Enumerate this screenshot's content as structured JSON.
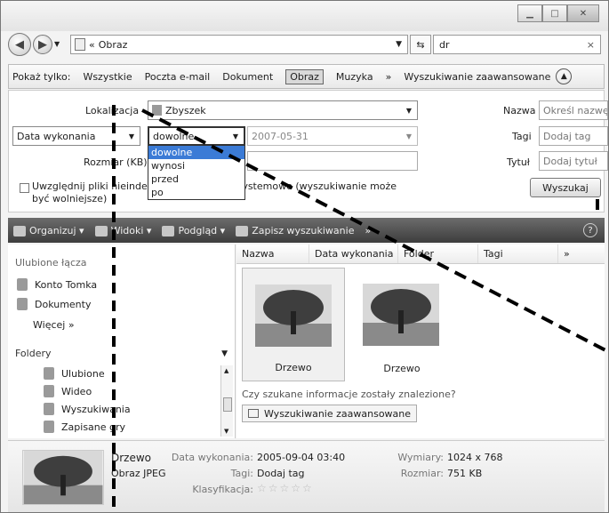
{
  "address": {
    "chevron": "«",
    "path": "Obraz",
    "search_value": "dr"
  },
  "showbar": {
    "label": "Pokaż tylko:",
    "items": [
      "Wszystkie",
      "Poczta e-mail",
      "Dokument",
      "Obraz",
      "Muzyka",
      "»",
      "Wyszukiwanie zaawansowane"
    ],
    "selected": "Obraz"
  },
  "advanced": {
    "location_label": "Lokalizacja",
    "location_value": "Zbyszek",
    "date_field": "Data wykonania",
    "date_operator": "dowolne",
    "date_value": "2007-05-31",
    "date_options": [
      "dowolne",
      "wynosi",
      "przed",
      "po"
    ],
    "size_label": "Rozmiar (KB)",
    "include_text": "Uwzględnij pliki nieindeksowane, ukryte i systemowe (wyszukiwanie może być wolniejsze)",
    "name_label": "Nazwa",
    "name_placeholder": "Określ nazwę",
    "tags_label": "Tagi",
    "tags_placeholder": "Dodaj tag",
    "title_label": "Tytuł",
    "title_placeholder": "Dodaj tytuł",
    "search_button": "Wyszukaj"
  },
  "toolbar": {
    "organize": "Organizuj",
    "views": "Widoki",
    "preview": "Podgląd",
    "save_search": "Zapisz wyszukiwanie",
    "more": "»",
    "help": "?"
  },
  "nav": {
    "favorites_title": "Ulubione łącza",
    "favorites": [
      "Konto Tomka",
      "Dokumenty"
    ],
    "more": "Więcej »",
    "folders_title": "Foldery",
    "folders": [
      "Ulubione",
      "Wideo",
      "Wyszukiwania",
      "Zapisane gry"
    ]
  },
  "content": {
    "columns": [
      "Nazwa",
      "Data wykonania",
      "Folder",
      "Tagi",
      "»"
    ],
    "items": [
      {
        "name": "Drzewo"
      },
      {
        "name": "Drzewo"
      }
    ],
    "question": "Czy szukane informacje zostały znalezione?",
    "advanced_button": "Wyszukiwanie zaawansowane"
  },
  "details": {
    "name": "Drzewo",
    "type": "Obraz JPEG",
    "date_label": "Data wykonania:",
    "date_value": "2005-09-04 03:40",
    "tags_label": "Tagi:",
    "tags_value": "Dodaj tag",
    "rating_label": "Klasyfikacja:",
    "rating_stars": "☆☆☆☆☆",
    "dims_label": "Wymiary:",
    "dims_value": "1024 x 768",
    "size_label": "Rozmiar:",
    "size_value": "751 KB"
  }
}
